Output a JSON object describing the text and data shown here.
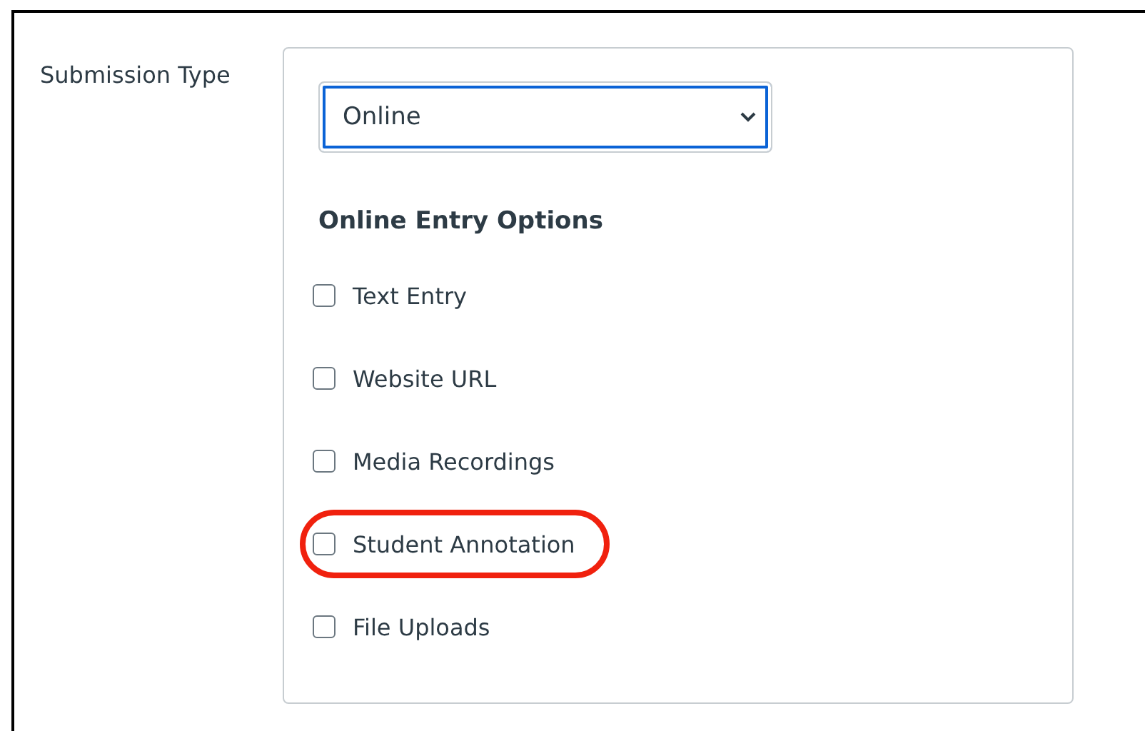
{
  "field_label": "Submission Type",
  "select": {
    "value": "Online"
  },
  "section_heading": "Online Entry Options",
  "options": [
    {
      "label": "Text Entry",
      "checked": false,
      "highlighted": false
    },
    {
      "label": "Website URL",
      "checked": false,
      "highlighted": false
    },
    {
      "label": "Media Recordings",
      "checked": false,
      "highlighted": false
    },
    {
      "label": "Student Annotation",
      "checked": false,
      "highlighted": true
    },
    {
      "label": "File Uploads",
      "checked": false,
      "highlighted": false
    }
  ]
}
